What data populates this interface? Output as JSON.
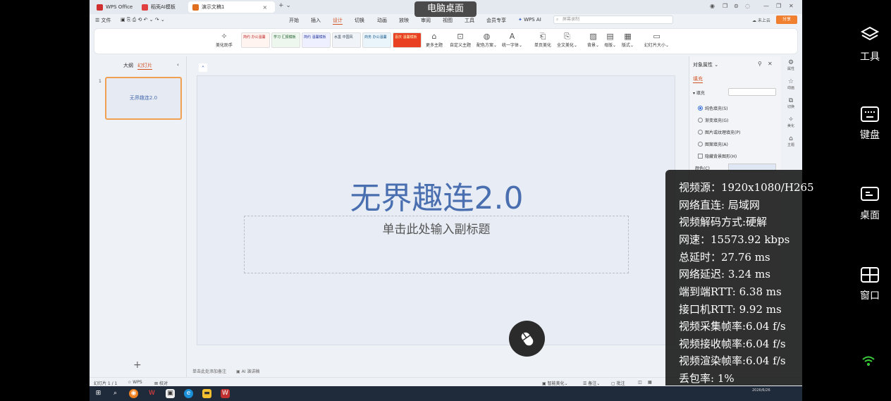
{
  "overlay": {
    "title": "电脑桌面"
  },
  "titlebar": {
    "tabs": [
      {
        "label": "WPS Office",
        "color": "#d03030"
      },
      {
        "label": "稻壳AI模板",
        "color": "#e04040"
      },
      {
        "label": "演示文稿1",
        "color": "#e07020"
      }
    ],
    "close": "×",
    "new_tab": "+ ⌄"
  },
  "menubar": {
    "file": "☰ 文件",
    "items": [
      "开始",
      "插入",
      "设计",
      "切换",
      "动画",
      "放映",
      "审阅",
      "视图",
      "工具",
      "会员专享",
      "WPS AI"
    ],
    "active_index": 2,
    "search_placeholder": "屏幕录制",
    "cloud": "未上云",
    "share": "分享"
  },
  "ribbon": {
    "beautify": "美化助手",
    "themes": [
      "简约 办公温馨",
      "学习 汇报模板",
      "简约 温馨模板",
      "水墨 中国风",
      "商务 办公温馨",
      "喜庆 温馨模板"
    ],
    "buttons": [
      "更多主题",
      "自定义主题",
      "配色方案⌄",
      "统一字体⌄",
      "单页美化",
      "全文美化⌄",
      "背景⌄",
      "母版⌄",
      "版式⌄",
      "幻灯片大小⌄"
    ]
  },
  "leftpane": {
    "tab_outline": "大纲",
    "tab_slides": "幻灯片",
    "collapse": "‹",
    "slide_number": "1",
    "thumb_title": "无界趣连2.0",
    "add": "+"
  },
  "slide": {
    "title": "无界趣连2.0",
    "subtitle": "单击此处输入副标题",
    "notes": "单击此处添加备注",
    "ai_notes": "AI 演讲稿"
  },
  "rightpane": {
    "title": "对象属性 ⌄",
    "tab_fill": "填充",
    "section": "▾ 填充",
    "options": [
      "纯色填充(S)",
      "渐变填充(G)",
      "图片或纹理填充(P)",
      "图案填充(A)"
    ],
    "hide_bg": "隐藏背景图形(H)",
    "color_label": "颜色(C)",
    "side_labels": [
      "属性",
      "动画",
      "切换",
      "美化",
      "主题"
    ]
  },
  "statusbar": {
    "slide_count": "幻灯片 1 / 1",
    "wps": "WPS",
    "check": "校对",
    "smart": "智能美化⌄",
    "notes": "备注⌄",
    "comments": "批注"
  },
  "taskbar": {
    "date": "2026/6/26"
  },
  "stats": [
    "视频源：1920x1080/H265",
    "网络直连: 局域网",
    "视频解码方式:硬解",
    "网速：15573.92 kbps",
    "总延时：27.76 ms",
    "网络延迟: 3.24 ms",
    "端到端RTT: 6.38 ms",
    "接口机RTT: 9.92 ms",
    "视频采集帧率:6.04 f/s",
    "视频接收帧率:6.04 f/s",
    "视频渲染帧率:6.04 f/s",
    "丢包率: 1%"
  ],
  "controller": [
    "工具",
    "键盘",
    "桌面",
    "窗口"
  ]
}
